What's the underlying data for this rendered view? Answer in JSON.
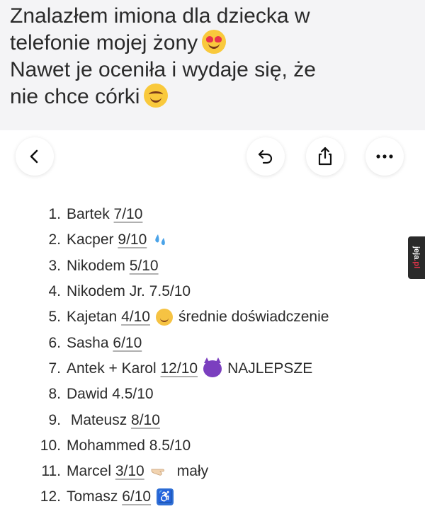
{
  "caption": {
    "line1": "Znalazłem imiona dla dziecka w",
    "line2": "telefonie mojej żony",
    "line3": "Nawet je oceniła i wydaje się, że",
    "line4": "nie chce córki",
    "emoji1": "heart-eyes-face",
    "emoji2": "smiling-face"
  },
  "toolbar": {
    "back_icon": "chevron-left",
    "undo_icon": "undo-arrow",
    "share_icon": "share-box-arrow",
    "more_icon": "more-dots"
  },
  "names": [
    {
      "num": "1.",
      "name": "Bartek",
      "score": "7/10",
      "underline": true
    },
    {
      "num": "2.",
      "name": "Kacper",
      "score": "9/10",
      "underline": true,
      "icon": "sweat-droplets-icon"
    },
    {
      "num": "3.",
      "name": "Nikodem",
      "score": "5/10",
      "underline": true
    },
    {
      "num": "4.",
      "name": "Nikodem Jr.",
      "score": "7.5/10",
      "underline": false
    },
    {
      "num": "5.",
      "name": "Kajetan",
      "score": "4/10",
      "underline": true,
      "icon": "flushed-face-icon",
      "suffix": "średnie doświadczenie"
    },
    {
      "num": "6.",
      "name": "Sasha",
      "score": "6/10",
      "underline": true
    },
    {
      "num": "7.",
      "name": "Antek + Karol",
      "score": "12/10",
      "underline": true,
      "icon": "devil-face-icon",
      "suffix": "NAJLEPSZE"
    },
    {
      "num": "8.",
      "name": "Dawid",
      "score": "4.5/10",
      "underline": false
    },
    {
      "num": "9.",
      "name": " Mateusz",
      "score": "8/10",
      "underline": true
    },
    {
      "num": "10.",
      "name": "Mohammed",
      "score": "8.5/10",
      "underline": false
    },
    {
      "num": "11.",
      "name": "Marcel",
      "score": "3/10",
      "underline": true,
      "icon": "pointing-hand-icon",
      "suffix": "mały"
    },
    {
      "num": "12.",
      "name": "Tomasz",
      "score": "6/10",
      "underline": true,
      "icon": "wheelchair-icon"
    }
  ],
  "watermark": {
    "text1": "jeja",
    "text2": ".pl"
  },
  "colors": {
    "accent": "#e8334a",
    "devil": "#7b3fbf",
    "access": "#2f6fd6",
    "sweat": "#4aa3e8"
  }
}
